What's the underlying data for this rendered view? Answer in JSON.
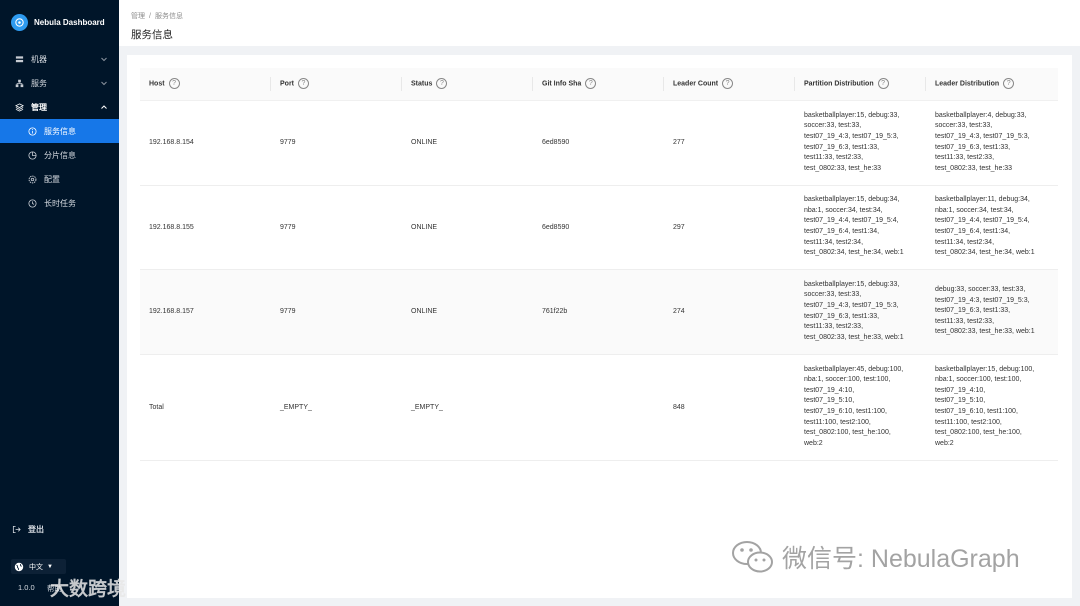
{
  "app": {
    "title": "Nebula Dashboard"
  },
  "sidebar": {
    "items": [
      {
        "label": "机器",
        "icon": "machine-icon"
      },
      {
        "label": "服务",
        "icon": "service-icon"
      },
      {
        "label": "管理",
        "icon": "management-icon"
      },
      {
        "label": "服务信息",
        "icon": "info-icon"
      },
      {
        "label": "分片信息",
        "icon": "partition-icon"
      },
      {
        "label": "配置",
        "icon": "config-icon"
      },
      {
        "label": "长时任务",
        "icon": "clock-icon"
      }
    ],
    "logout_label": "登出",
    "language": "中文",
    "version": "1.0.0",
    "help_label": "帮助"
  },
  "header": {
    "breadcrumb": [
      "管理",
      "服务信息"
    ],
    "title": "服务信息"
  },
  "table": {
    "columns": [
      "Host",
      "Port",
      "Status",
      "Git Info Sha",
      "Leader Count",
      "Partition Distribution",
      "Leader Distribution"
    ],
    "rows": [
      {
        "host": "192.168.8.154",
        "port": "9779",
        "status": "ONLINE",
        "git_sha": "6ed8590",
        "leader_count": "277",
        "partition": [
          "basketballplayer:15, debug:33,",
          "soccer:33, test:33,",
          "test07_19_4:3, test07_19_5:3,",
          "test07_19_6:3, test1:33,",
          "test11:33, test2:33,",
          "test_0802:33, test_he:33"
        ],
        "leader": [
          "basketballplayer:4, debug:33,",
          "soccer:33, test:33,",
          "test07_19_4:3, test07_19_5:3,",
          "test07_19_6:3, test1:33,",
          "test11:33, test2:33,",
          "test_0802:33, test_he:33"
        ]
      },
      {
        "host": "192.168.8.155",
        "port": "9779",
        "status": "ONLINE",
        "git_sha": "6ed8590",
        "leader_count": "297",
        "partition": [
          "basketballplayer:15, debug:34,",
          "nba:1, soccer:34, test:34,",
          "test07_19_4:4, test07_19_5:4,",
          "test07_19_6:4, test1:34,",
          "test11:34, test2:34,",
          "test_0802:34, test_he:34, web:1"
        ],
        "leader": [
          "basketballplayer:11, debug:34,",
          "nba:1, soccer:34, test:34,",
          "test07_19_4:4, test07_19_5:4,",
          "test07_19_6:4, test1:34,",
          "test11:34, test2:34,",
          "test_0802:34, test_he:34, web:1"
        ]
      },
      {
        "host": "192.168.8.157",
        "port": "9779",
        "status": "ONLINE",
        "git_sha": "761f22b",
        "leader_count": "274",
        "partition": [
          "basketballplayer:15, debug:33,",
          "soccer:33, test:33,",
          "test07_19_4:3, test07_19_5:3,",
          "test07_19_6:3, test1:33,",
          "test11:33, test2:33,",
          "test_0802:33, test_he:33, web:1"
        ],
        "leader": [
          "debug:33, soccer:33, test:33,",
          "test07_19_4:3, test07_19_5:3,",
          "test07_19_6:3, test1:33,",
          "test11:33, test2:33,",
          "test_0802:33, test_he:33, web:1"
        ]
      },
      {
        "host": "Total",
        "port": "_EMPTY_",
        "status": "_EMPTY_",
        "git_sha": "",
        "leader_count": "848",
        "partition": [
          "basketballplayer:45, debug:100,",
          "nba:1, soccer:100, test:100,",
          "test07_19_4:10,",
          "test07_19_5:10,",
          "test07_19_6:10, test1:100,",
          "test11:100, test2:100,",
          "test_0802:100, test_he:100,",
          "web:2"
        ],
        "leader": [
          "basketballplayer:15, debug:100,",
          "nba:1, soccer:100, test:100,",
          "test07_19_4:10,",
          "test07_19_5:10,",
          "test07_19_6:10, test1:100,",
          "test11:100, test2:100,",
          "test_0802:100, test_he:100,",
          "web:2"
        ]
      }
    ]
  },
  "watermarks": {
    "wechat": "微信号: NebulaGraph",
    "cross": "大数跨境"
  },
  "colors": {
    "sidebar_bg": "#001529",
    "active_bg": "#1677e8",
    "online": "#21b839"
  }
}
